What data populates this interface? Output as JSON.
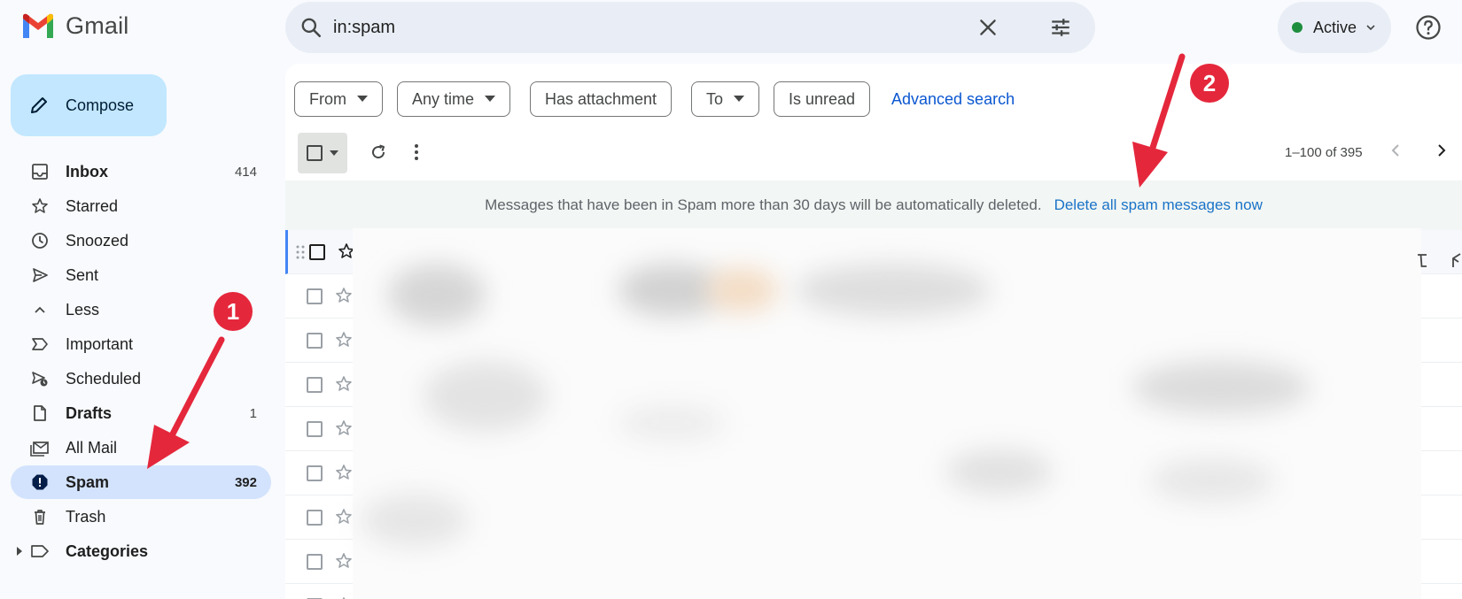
{
  "app": {
    "name": "Gmail"
  },
  "search": {
    "query": "in:spam"
  },
  "status": {
    "label": "Active",
    "color": "#1e8e3e"
  },
  "compose": {
    "label": "Compose"
  },
  "nav": [
    {
      "label": "Inbox",
      "count": "414",
      "icon": "inbox-icon",
      "bold": true
    },
    {
      "label": "Starred",
      "count": "",
      "icon": "star-icon"
    },
    {
      "label": "Snoozed",
      "count": "",
      "icon": "clock-icon"
    },
    {
      "label": "Sent",
      "count": "",
      "icon": "send-icon"
    },
    {
      "label": "Less",
      "count": "",
      "icon": "chevron-up-icon"
    },
    {
      "label": "Important",
      "count": "",
      "icon": "important-icon"
    },
    {
      "label": "Scheduled",
      "count": "",
      "icon": "scheduled-icon"
    },
    {
      "label": "Drafts",
      "count": "1",
      "icon": "draft-icon",
      "bold": true
    },
    {
      "label": "All Mail",
      "count": "",
      "icon": "all-mail-icon"
    },
    {
      "label": "Spam",
      "count": "392",
      "icon": "spam-icon",
      "bold": true,
      "active": true
    },
    {
      "label": "Trash",
      "count": "",
      "icon": "trash-icon"
    },
    {
      "label": "Categories",
      "count": "",
      "icon": "label-icon",
      "bold": true
    }
  ],
  "filters": {
    "from": "From",
    "any_time": "Any time",
    "has_attachment": "Has attachment",
    "to": "To",
    "is_unread": "Is unread",
    "advanced": "Advanced search"
  },
  "pager": {
    "range": "1–100 of 395"
  },
  "banner": {
    "message": "Messages that have been in Spam more than 30 days will be automatically deleted.",
    "action": "Delete all spam messages now"
  },
  "annotations": {
    "step1": "1",
    "step2": "2",
    "color": "#e5273c"
  },
  "colors": {
    "accent": "#0b57d0",
    "compose_bg": "#c2e7ff",
    "active_bg": "#d3e3fd"
  }
}
